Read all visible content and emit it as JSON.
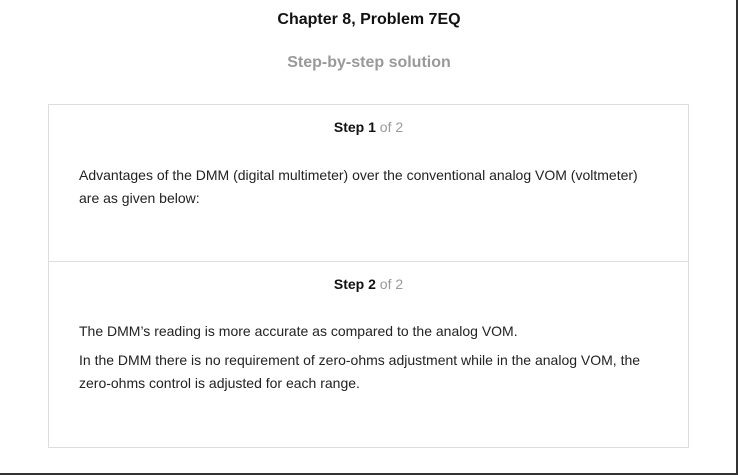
{
  "header": {
    "chapter_title": "Chapter 8, Problem 7EQ",
    "subtitle": "Step-by-step solution"
  },
  "steps": [
    {
      "label": "Step",
      "number": "1",
      "of_text": "of 2",
      "paragraphs": [
        "Advantages of the DMM (digital multimeter) over the conventional analog VOM (voltmeter) are as given below:"
      ]
    },
    {
      "label": "Step",
      "number": "2",
      "of_text": "of 2",
      "paragraphs": [
        "The DMM’s reading is more accurate as compared to the analog VOM.",
        "In the DMM there is no requirement of zero-ohms adjustment while in the analog VOM, the zero-ohms control is adjusted for each range."
      ]
    }
  ]
}
